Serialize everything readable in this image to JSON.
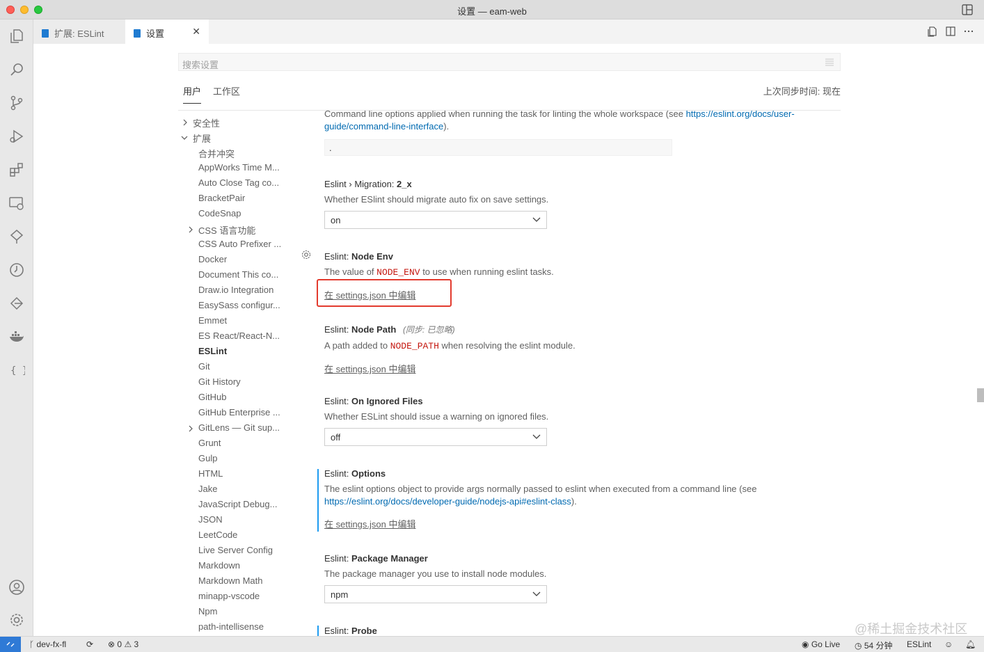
{
  "window": {
    "title": "设置 — eam-web"
  },
  "tabs": [
    {
      "label": "扩展: ESLint"
    },
    {
      "label": "设置"
    }
  ],
  "search": {
    "placeholder": "搜索设置"
  },
  "settings_tabs": {
    "user": "用户",
    "workspace": "工作区",
    "sync_time": "上次同步时间: 现在"
  },
  "toc": [
    "安全性",
    "扩展",
    "合并冲突",
    "AppWorks Time M...",
    "Auto Close Tag co...",
    "BracketPair",
    "CodeSnap",
    "CSS 语言功能",
    "CSS Auto Prefixer ...",
    "Docker",
    "Document This co...",
    "Draw.io Integration",
    "EasySass configur...",
    "Emmet",
    "ES React/React-N...",
    "ESLint",
    "Git",
    "Git History",
    "GitHub",
    "GitHub Enterprise ...",
    "GitLens — Git sup...",
    "Grunt",
    "Gulp",
    "HTML",
    "Jake",
    "JavaScript Debug...",
    "JSON",
    "LeetCode",
    "Live Server Config",
    "Markdown",
    "Markdown Math",
    "minapp-vscode",
    "Npm",
    "path-intellisense"
  ],
  "settings": {
    "cmdline": {
      "desc_pre": "Command line options applied when running the task for linting the whole workspace (see ",
      "link": "https://eslint.org/docs/user-guide/command-line-interface",
      "link_line1": "https://eslint.org/docs/user-",
      "link_line2": "guide/command-line-interface",
      "desc_post": ").",
      "value": "."
    },
    "migration": {
      "category": "Eslint › Migration: ",
      "name": "2_x",
      "desc": "Whether ESlint should migrate auto fix on save settings.",
      "value": "on"
    },
    "node_env": {
      "category": "Eslint: ",
      "name": "Node Env",
      "desc_pre": "The value of ",
      "code": "NODE_ENV",
      "desc_post": " to use when running eslint tasks.",
      "edit": "在 settings.json 中编辑"
    },
    "node_path": {
      "category": "Eslint: ",
      "name": "Node Path",
      "sync": "(同步: 已忽略)",
      "desc_pre": "A path added to ",
      "code": "NODE_PATH",
      "desc_post": " when resolving the eslint module.",
      "edit": "在 settings.json 中编辑"
    },
    "ignored": {
      "category": "Eslint: ",
      "name": "On Ignored Files",
      "desc": "Whether ESLint should issue a warning on ignored files.",
      "value": "off"
    },
    "options": {
      "category": "Eslint: ",
      "name": "Options",
      "desc": "The eslint options object to provide args normally passed to eslint when executed from a command line (see",
      "link": "https://eslint.org/docs/developer-guide/nodejs-api#eslint-class",
      "desc_post": ").",
      "edit": "在 settings.json 中编辑"
    },
    "package_manager": {
      "category": "Eslint: ",
      "name": "Package Manager",
      "desc": "The package manager you use to install node modules.",
      "value": "npm"
    },
    "probe": {
      "category": "Eslint: ",
      "name": "Probe"
    }
  },
  "statusbar": {
    "branch": "dev-fx-fl",
    "errors": "0",
    "warnings": "3",
    "golive": "Go Live",
    "time": "54 分钟",
    "eslint": "ESLint"
  },
  "watermark": "@稀土掘金技术社区",
  "colors": {
    "accent": "#006ab1",
    "modified": "#1f9cf0",
    "highlight_box": "#e33b2e",
    "code": "#c4170f"
  }
}
